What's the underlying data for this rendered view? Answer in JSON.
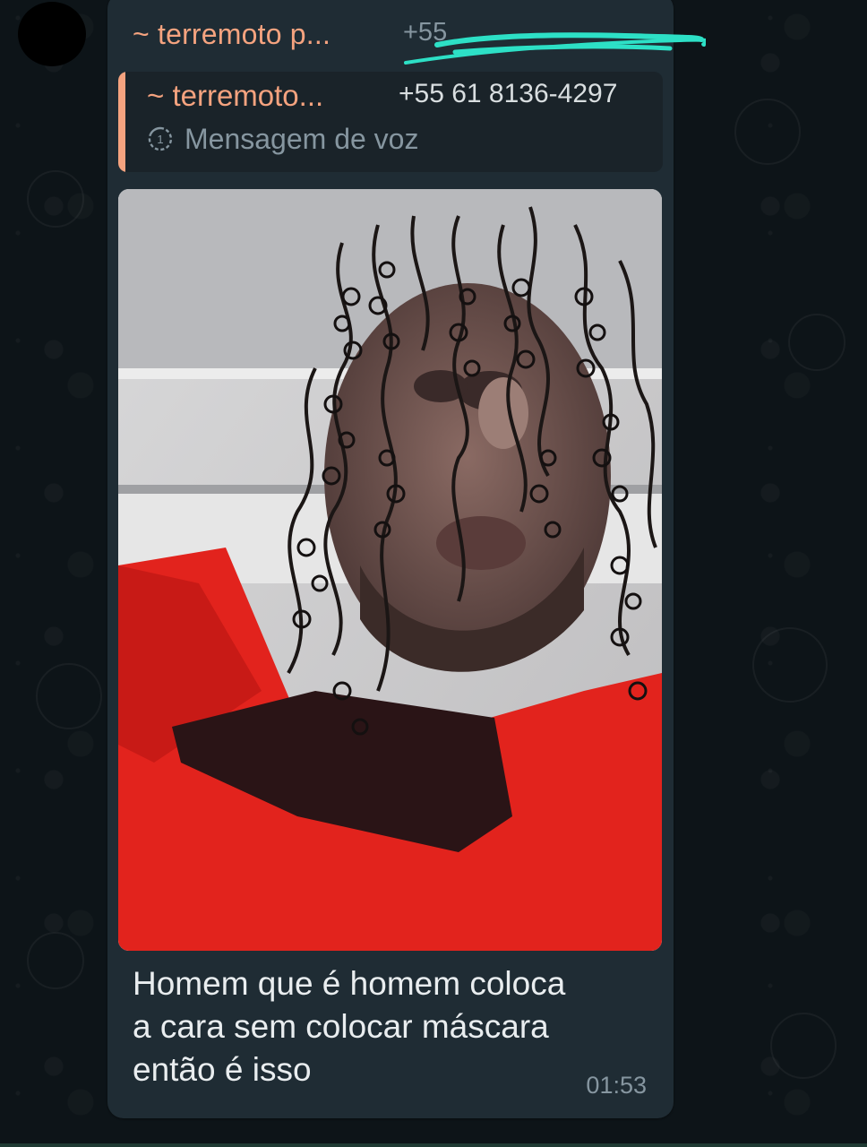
{
  "message": {
    "sender_name": "~ terremoto p...",
    "sender_phone_redacted": "+55",
    "quoted": {
      "sender_name": "~ terremoto...",
      "sender_phone": "+55 61 8136-4297",
      "timer_icon": "view-once-1-icon",
      "type_label": "Mensagem de voz"
    },
    "media": {
      "kind": "image"
    },
    "caption_lines": [
      "Homem que é homem coloca",
      "a cara sem colocar máscara",
      "então é isso"
    ],
    "time": "01:53"
  },
  "colors": {
    "wallpaper": "#0d1418",
    "bubble": "#1f2c34",
    "quote_bg": "#1a2329",
    "accent_name": "#f5a37f",
    "muted_text": "#8696a0",
    "text": "#e9edef",
    "redaction_marker": "#2de0c6"
  }
}
